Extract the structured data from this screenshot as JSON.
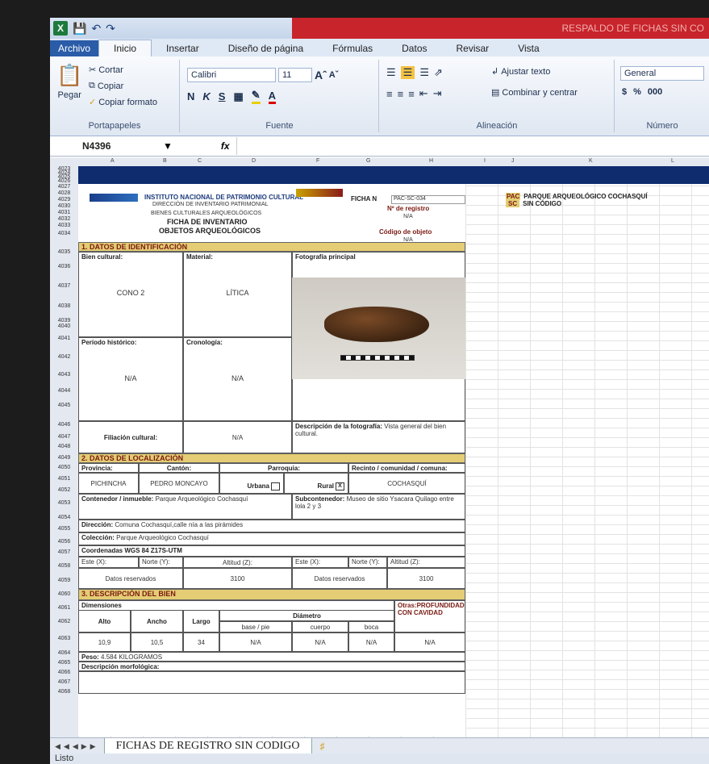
{
  "window": {
    "title": "RESPALDO DE FICHAS SIN CO"
  },
  "ribbon_tabs": [
    "Archivo",
    "Inicio",
    "Insertar",
    "Diseño de página",
    "Fórmulas",
    "Datos",
    "Revisar",
    "Vista"
  ],
  "clipboard": {
    "paste": "Pegar",
    "cut": "Cortar",
    "copy": "Copiar",
    "format_painter": "Copiar formato",
    "group": "Portapapeles"
  },
  "font": {
    "name": "Calibri",
    "size": "11",
    "bold": "N",
    "italic": "K",
    "underline": "S",
    "group": "Fuente"
  },
  "alignment": {
    "wrap": "Ajustar texto",
    "merge": "Combinar y centrar",
    "group": "Alineación"
  },
  "number": {
    "format": "General",
    "currency": "$",
    "percent": "%",
    "thousands": "000",
    "group": "Número"
  },
  "formula_bar": {
    "name_box": "N4396",
    "fx": "fx"
  },
  "columns": [
    "A",
    "B",
    "C",
    "D",
    "F",
    "G",
    "H",
    "I",
    "J",
    "K",
    "L"
  ],
  "rows": [
    "4023",
    "4024",
    "4025",
    "4026",
    "4027",
    "4028",
    "4029",
    "4030",
    "4031",
    "4032",
    "4033",
    "4034",
    "4035",
    "4036",
    "4037",
    "4038",
    "4039",
    "4040",
    "4041",
    "4042",
    "4043",
    "4044",
    "4045",
    "4046",
    "4047",
    "4048",
    "4049",
    "4050",
    "4051",
    "4052",
    "4053",
    "4054",
    "4055",
    "4056",
    "4057",
    "4058",
    "4059",
    "4060",
    "4061",
    "4062",
    "4063",
    "4064",
    "4065",
    "4066",
    "4067",
    "4068"
  ],
  "form": {
    "institute": "INSTITUTO NACIONAL DE PATRIMONIO CULTURAL",
    "dept": "DIRECCIÓN DE INVENTARIO PATRIMONIAL",
    "bienes": "BIENES CULTURALES ARQUEOLÓGICOS",
    "ficha_title": "FICHA DE INVENTARIO",
    "obj_title": "OBJETOS ARQUEOLÓGICOS",
    "ficha_n_label": "FICHA N",
    "ficha_n": "PAC-SC-034",
    "registro_label": "Nº de registro",
    "registro": "N/A",
    "codigo_label": "Código de objeto",
    "codigo": "N/A",
    "s1": "1. DATOS DE IDENTIFICACIÓN",
    "bien_label": "Bien cultural:",
    "bien": "CONO 2",
    "material_label": "Material:",
    "material": "LÍTICA",
    "foto_label": "Fotografía principal",
    "periodo_label": "Período histórico:",
    "periodo": "N/A",
    "crono_label": "Cronología:",
    "crono": "N/A",
    "filiacion_label": "Filiación cultural:",
    "filiacion": "N/A",
    "desc_foto_label": "Descripción de la fotografía:",
    "desc_foto": "Vista general del bien cultural.",
    "s2": "2. DATOS DE LOCALIZACIÓN",
    "provincia_label": "Provincia:",
    "provincia": "PICHINCHA",
    "canton_label": "Cantón:",
    "canton": "PEDRO MONCAYO",
    "parroquia_label": "Parroquia:",
    "urbana": "Urbana",
    "rural": "Rural",
    "rural_check": "X",
    "recinto_label": "Recinto / comunidad / comuna:",
    "recinto": "COCHASQUÍ",
    "contenedor_label": "Contenedor / inmueble:",
    "contenedor": "Parque Arqueológico Cochasquí",
    "subcont_label": "Subcontenedor:",
    "subcont": "Museo de sitio Ysacara Quilago entre lola 2 y 3",
    "direccion_label": "Dirección:",
    "direccion": "Comuna Cochasquí,calle nía a las pirámides",
    "coleccion_label": "Colección:",
    "coleccion": "Parque Arqueológico Cochasquí",
    "coord_label": "Coordenadas WGS 84 Z17S-UTM",
    "este_label": "Este (X):",
    "norte_label": "Norte (Y):",
    "altitud_label": "Altitud (Z):",
    "datos_reservados": "Datos reservados",
    "altitud": "3100",
    "s3": "3. DESCRIPCIÓN DEL BIEN",
    "dim_label": "Dimensiones",
    "alto_label": "Alto",
    "ancho_label": "Ancho",
    "largo_label": "Largo",
    "diametro_label": "Diámetro",
    "base_label": "base / pie",
    "cuerpo_label": "cuerpo",
    "boca_label": "boca",
    "otras_label": "Otras:PROFUNDIDAD CON CAVIDAD",
    "alto": "10,9",
    "ancho": "10,5",
    "largo": "34",
    "base": "N/A",
    "cuerpo": "N/A",
    "boca": "N/A",
    "otras": "N/A",
    "peso_label": "Peso:",
    "peso": "4.584 KILOGRAMOS",
    "morfo_label": "Descripción morfológica:"
  },
  "right_panel": {
    "r1_code": "PAC",
    "r1_text": "PARQUE ARQUEOLÓGICO COCHASQUÍ",
    "r2_code": "SC",
    "r2_text": "SIN CÓDIGO"
  },
  "sheet_tab": "FICHAS DE REGISTRO SIN CODIGO",
  "status": "Listo"
}
